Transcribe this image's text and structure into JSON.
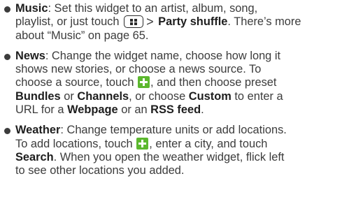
{
  "items": [
    {
      "term": "Music",
      "lines": [
        ": Set this widget to an artist, album, song,",
        "playlist, or just touch",
        "Party shuffle",
        ". There’s more",
        "about “Music” on page 65."
      ]
    },
    {
      "term": "News",
      "lines": [
        ": Change the widget name, choose how long it",
        "shows new stories, or choose a news source. To",
        "choose a source, touch",
        ", and then choose preset",
        "Bundles",
        " or ",
        "Channels",
        ", or choose ",
        "Custom",
        " to enter a",
        "URL for a ",
        "Webpage",
        " or an ",
        "RSS feed",
        "."
      ]
    },
    {
      "term": "Weather",
      "lines": [
        ": Change temperature units or add locations.",
        "To add locations, touch",
        ", enter a city, and touch",
        "Search",
        ". When you open the weather widget, flick left",
        "to see other locations you added."
      ]
    }
  ],
  "icons": {
    "menu_key": "menu-key-icon",
    "arrow": ">",
    "add": "add-icon"
  },
  "colors": {
    "text": "#3c3c3c",
    "bold": "#1e1e1e",
    "add_icon_bg": "#5cb82e"
  }
}
